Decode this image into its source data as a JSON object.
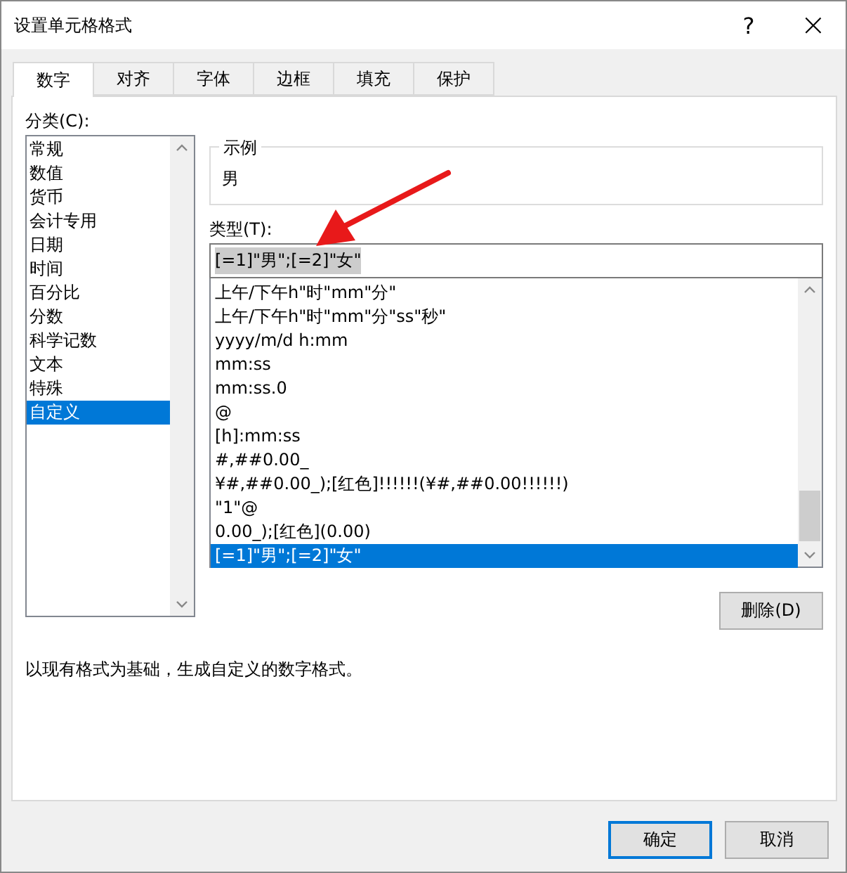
{
  "window": {
    "title": "设置单元格格式",
    "help": "?",
    "close": "×"
  },
  "tabs": [
    {
      "label": "数字",
      "selected": true
    },
    {
      "label": "对齐",
      "selected": false
    },
    {
      "label": "字体",
      "selected": false
    },
    {
      "label": "边框",
      "selected": false
    },
    {
      "label": "填充",
      "selected": false
    },
    {
      "label": "保护",
      "selected": false
    }
  ],
  "category": {
    "label": "分类(C):",
    "items": [
      {
        "label": "常规",
        "selected": false
      },
      {
        "label": "数值",
        "selected": false
      },
      {
        "label": "货币",
        "selected": false
      },
      {
        "label": "会计专用",
        "selected": false
      },
      {
        "label": "日期",
        "selected": false
      },
      {
        "label": "时间",
        "selected": false
      },
      {
        "label": "百分比",
        "selected": false
      },
      {
        "label": "分数",
        "selected": false
      },
      {
        "label": "科学记数",
        "selected": false
      },
      {
        "label": "文本",
        "selected": false
      },
      {
        "label": "特殊",
        "selected": false
      },
      {
        "label": "自定义",
        "selected": true
      }
    ]
  },
  "sample": {
    "label": "示例",
    "value": "男"
  },
  "type": {
    "label": "类型(T):",
    "value": "[=1]\"男\";[=2]\"女\"",
    "formats": [
      {
        "label": "上午/下午h\"时\"mm\"分\"",
        "selected": false
      },
      {
        "label": "上午/下午h\"时\"mm\"分\"ss\"秒\"",
        "selected": false
      },
      {
        "label": "yyyy/m/d h:mm",
        "selected": false
      },
      {
        "label": "mm:ss",
        "selected": false
      },
      {
        "label": "mm:ss.0",
        "selected": false
      },
      {
        "label": "@",
        "selected": false
      },
      {
        "label": "[h]:mm:ss",
        "selected": false
      },
      {
        "label": "#,##0.00_",
        "selected": false
      },
      {
        "label": "¥#,##0.00_);[红色]!!!!!!(¥#,##0.00!!!!!!)",
        "selected": false
      },
      {
        "label": "\"1\"@",
        "selected": false
      },
      {
        "label": "0.00_);[红色](0.00)",
        "selected": false
      },
      {
        "label": "[=1]\"男\";[=2]\"女\"",
        "selected": true
      }
    ]
  },
  "delete_button": "删除(D)",
  "description": "以现有格式为基础，生成自定义的数字格式。",
  "buttons": [
    "确定",
    "取消"
  ]
}
